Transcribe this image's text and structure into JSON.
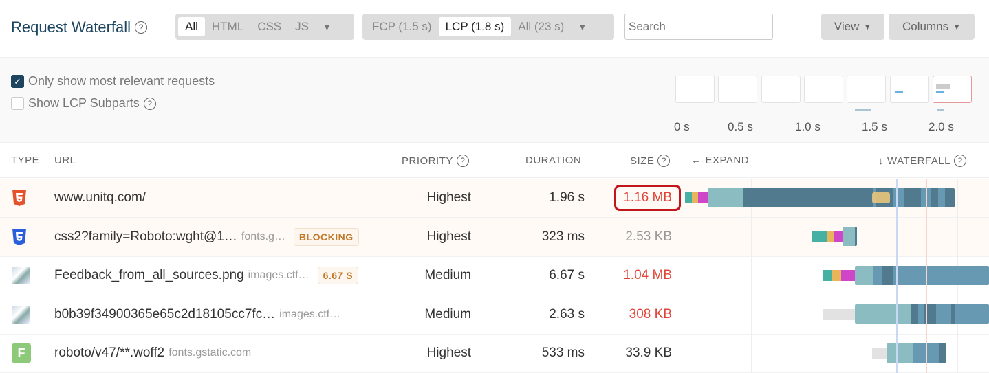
{
  "header": {
    "title": "Request Waterfall",
    "type_filters": [
      "All",
      "HTML",
      "CSS",
      "JS"
    ],
    "type_selected": "All",
    "milestones": [
      "FCP (1.5 s)",
      "LCP (1.8 s)",
      "All (23 s)"
    ],
    "milestone_selected": "LCP (1.8 s)",
    "search_placeholder": "Search",
    "view_label": "View",
    "columns_label": "Columns"
  },
  "filters": {
    "relevant": {
      "label": "Only show most relevant requests",
      "checked": true
    },
    "lcp_subparts": {
      "label": "Show LCP Subparts",
      "checked": false
    }
  },
  "filmstrip": {
    "ticks": [
      "0 s",
      "0.5 s",
      "1.0 s",
      "1.5 s",
      "2.0 s"
    ]
  },
  "columns": {
    "type": "TYPE",
    "url": "URL",
    "priority": "PRIORITY",
    "duration": "DURATION",
    "size": "SIZE",
    "expand": "EXPAND",
    "waterfall": "WATERFALL"
  },
  "rows": [
    {
      "type": "html",
      "url": "www.unitq.com/",
      "host": "",
      "badge": "",
      "priority": "Highest",
      "duration": "1.96 s",
      "size": "1.16 MB",
      "size_color": "#e0453a",
      "highlighted": true
    },
    {
      "type": "css",
      "url": "css2?family=Roboto:wght@1…",
      "host": "fonts.g…",
      "badge": "BLOCKING",
      "priority": "Highest",
      "duration": "323 ms",
      "size": "2.53 KB",
      "size_color": "#999999"
    },
    {
      "type": "image",
      "url": "Feedback_from_all_sources.png",
      "host": "images.ctf…",
      "badge": "6.67 S",
      "priority": "Medium",
      "duration": "6.67 s",
      "size": "1.04 MB",
      "size_color": "#e0453a"
    },
    {
      "type": "image",
      "url": "b0b39f34900365e65c2d18105cc7fc…",
      "host": "images.ctf…",
      "badge": "",
      "priority": "Medium",
      "duration": "2.63 s",
      "size": "308 KB",
      "size_color": "#e0453a"
    },
    {
      "type": "font",
      "url": "roboto/v47/**.woff2",
      "host": "fonts.gstatic.com",
      "badge": "",
      "priority": "Highest",
      "duration": "533 ms",
      "size": "33.9 KB",
      "size_color": "#333333"
    }
  ],
  "colors": {
    "dns": "#46b1a3",
    "connect": "#e8b55a",
    "ssl": "#d046c8",
    "wait": "#8bbcc2",
    "download": "#6899b3",
    "download_dark": "#527a8e",
    "fcp_line": "#c9d9f5",
    "lcp_line": "#f3d5cc",
    "highlight_border": "#c0171d"
  },
  "icons": {
    "html": "html5-icon",
    "css": "css3-icon",
    "image": "image-thumbnail-icon",
    "font": "font-icon"
  }
}
